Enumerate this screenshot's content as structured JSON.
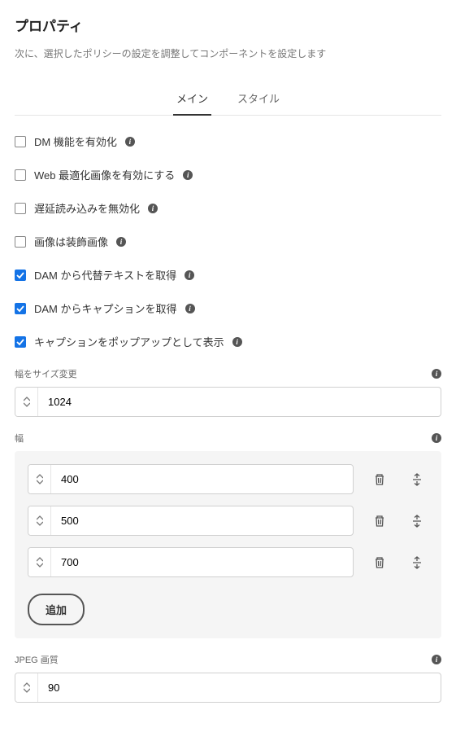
{
  "title": "プロパティ",
  "subtitle": "次に、選択したポリシーの設定を調整してコンポーネントを設定します",
  "tabs": {
    "main": "メイン",
    "style": "スタイル"
  },
  "checkboxes": {
    "dm": {
      "label": "DM 機能を有効化",
      "checked": false
    },
    "webopt": {
      "label": "Web 最適化画像を有効にする",
      "checked": false
    },
    "lazy": {
      "label": "遅延読み込みを無効化",
      "checked": false
    },
    "decorative": {
      "label": "画像は装飾画像",
      "checked": false
    },
    "damAlt": {
      "label": "DAM から代替テキストを取得",
      "checked": true
    },
    "damCaption": {
      "label": "DAM からキャプションを取得",
      "checked": true
    },
    "popupCaption": {
      "label": "キャプションをポップアップとして表示",
      "checked": true
    }
  },
  "resizeWidth": {
    "label": "幅をサイズ変更",
    "value": "1024"
  },
  "widths": {
    "label": "幅",
    "items": [
      "400",
      "500",
      "700"
    ],
    "addLabel": "追加"
  },
  "jpegQuality": {
    "label": "JPEG 画質",
    "value": "90"
  }
}
